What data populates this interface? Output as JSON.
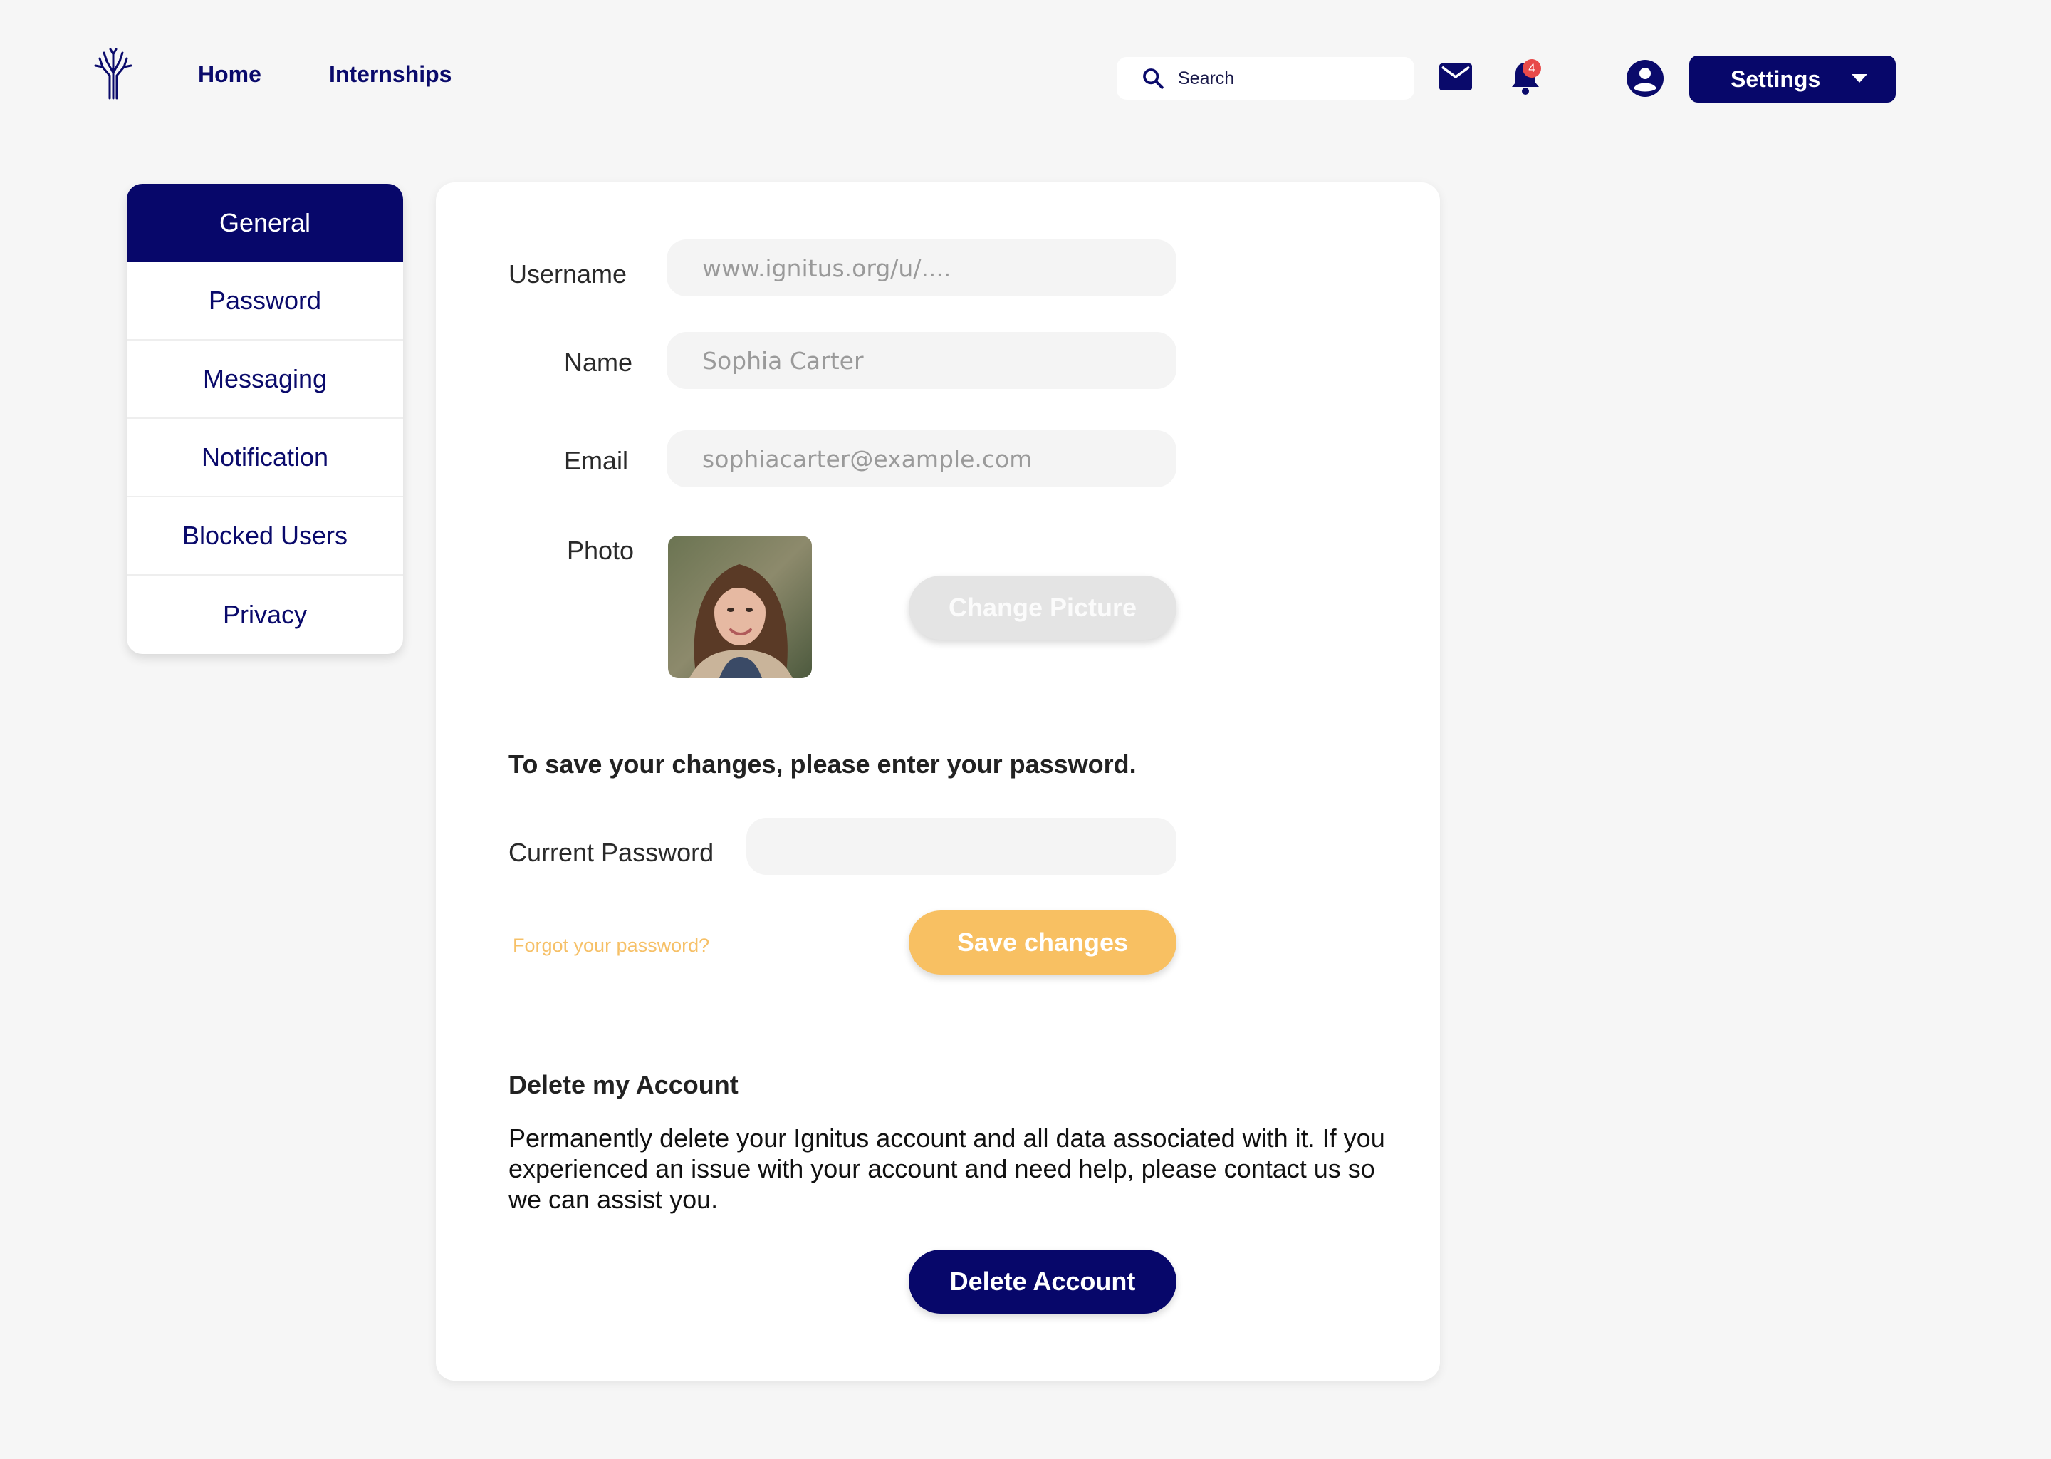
{
  "nav": {
    "home": "Home",
    "internships": "Internships",
    "search_placeholder": "Search",
    "notification_count": "4",
    "settings_label": "Settings"
  },
  "side_menu": {
    "items": [
      {
        "label": "General",
        "active": true
      },
      {
        "label": "Password"
      },
      {
        "label": "Messaging"
      },
      {
        "label": "Notification"
      },
      {
        "label": "Blocked Users"
      },
      {
        "label": "Privacy"
      }
    ]
  },
  "form": {
    "username_label": "Username",
    "username_placeholder": "www.ignitus.org/u/....",
    "name_label": "Name",
    "name_placeholder": "Sophia Carter",
    "email_label": "Email",
    "email_placeholder": "sophiacarter@example.com",
    "photo_label": "Photo",
    "change_picture": "Change Picture",
    "password_prompt": "To save your changes, please enter your password.",
    "current_password_label": "Current Password",
    "forgot_password": "Forgot your password?",
    "save_changes": "Save changes"
  },
  "delete_section": {
    "title": "Delete my Account",
    "description": "Permanently delete your Ignitus account and all data associated with it. If you experienced an issue with your account and need help, please contact us so we can assist you.",
    "button": "Delete Account"
  },
  "colors": {
    "brand": "#07076a",
    "accent": "#f8c062",
    "badge": "#e84a4a",
    "background": "#f6f6f6"
  },
  "icons": {
    "logo": "tree-logo-icon",
    "search": "search-icon",
    "mail": "mail-icon",
    "bell": "bell-icon",
    "account": "account-circle-icon",
    "caret": "caret-down-icon"
  }
}
